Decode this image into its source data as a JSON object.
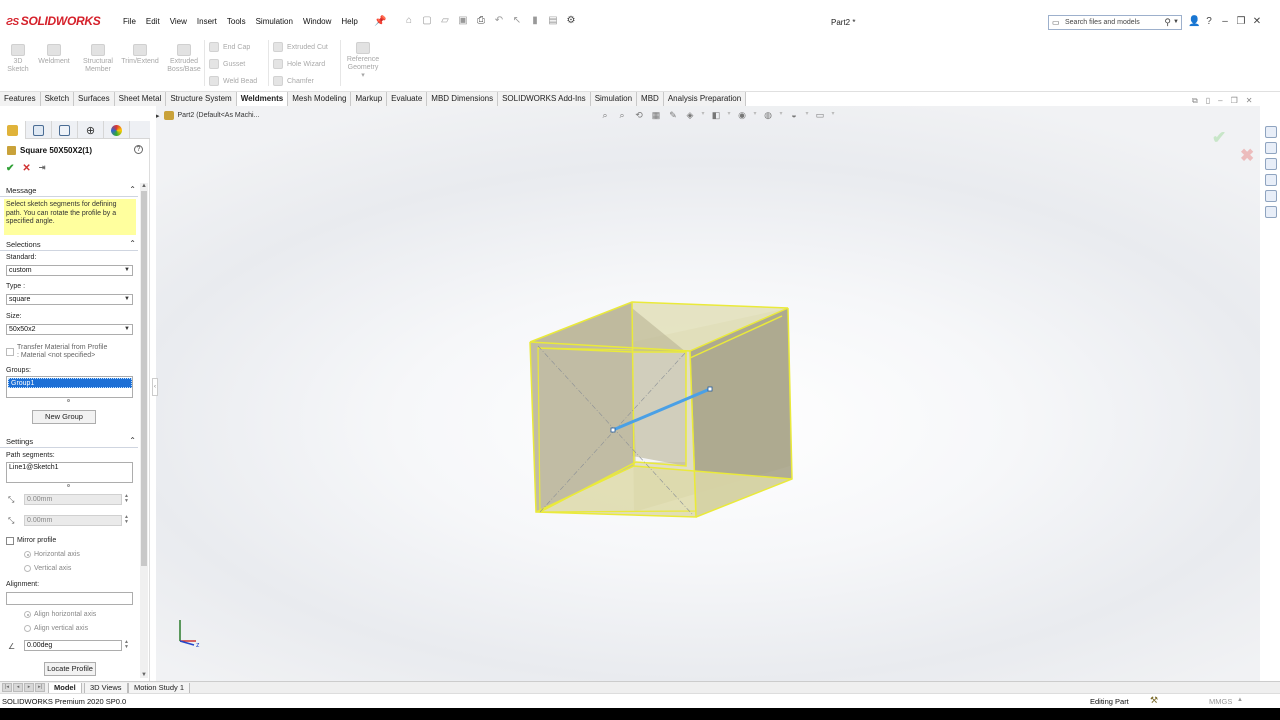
{
  "app": {
    "logo": "SOLIDWORKS",
    "document_title": "Part2 *",
    "menus": [
      "File",
      "Edit",
      "View",
      "Insert",
      "Tools",
      "Simulation",
      "Window",
      "Help"
    ],
    "search_placeholder": "Search files and models"
  },
  "toolbar": {
    "sketch3d": [
      "3D",
      "Sketch"
    ],
    "weldment": "Weldment",
    "structural_member": [
      "Structural",
      "Member"
    ],
    "trim_extend": "Trim/Extend",
    "extruded_boss": [
      "Extruded",
      "Boss/Base"
    ],
    "end_cap": "End Cap",
    "gusset": "Gusset",
    "weld_bead": "Weld Bead",
    "extruded_cut": "Extruded Cut",
    "hole_wizard": "Hole Wizard",
    "chamfer": "Chamfer",
    "reference_geometry": [
      "Reference",
      "Geometry"
    ]
  },
  "tabs": [
    "Features",
    "Sketch",
    "Surfaces",
    "Sheet Metal",
    "Structure System",
    "Weldments",
    "Mesh Modeling",
    "Markup",
    "Evaluate",
    "MBD Dimensions",
    "SOLIDWORKS Add-Ins",
    "Simulation",
    "MBD",
    "Analysis Preparation"
  ],
  "active_tab": "Weldments",
  "property_manager": {
    "title": "Square 50X50X2(1)",
    "message_header": "Message",
    "message": "Select sketch segments for defining path. You can rotate the profile by a specified angle.",
    "selections_header": "Selections",
    "standard_label": "Standard:",
    "standard_value": "custom",
    "type_label": "Type :",
    "type_value": "square",
    "size_label": "Size:",
    "size_value": "50x50x2",
    "transfer_material": "Transfer Material from Profile",
    "material_note": ": Material <not specified>",
    "groups_label": "Groups:",
    "group1": "Group1",
    "new_group": "New Group",
    "settings_header": "Settings",
    "path_segments_label": "Path segments:",
    "path_segment_value": "Line1@Sketch1",
    "offset1": "0.00mm",
    "offset2": "0.00mm",
    "mirror_profile": "Mirror profile",
    "horizontal_axis": "Horizontal axis",
    "vertical_axis": "Vertical axis",
    "alignment_label": "Alignment:",
    "align_horizontal": "Align horizontal axis",
    "align_vertical": "Align vertical axis",
    "angle": "0.00deg",
    "locate_profile": "Locate Profile"
  },
  "feature_tree": {
    "label": "Part2  (Default<As Machi..."
  },
  "bottom_tabs": [
    "Model",
    "3D Views",
    "Motion Study 1"
  ],
  "active_bottom_tab": "Model",
  "status": {
    "version": "SOLIDWORKS Premium 2020 SP0.0",
    "mode": "Editing Part",
    "units": "MMGS"
  },
  "colors": {
    "brand_red": "#d5202a",
    "selection_blue": "#1c6fd6",
    "message_yellow": "#ffff9e",
    "edge_highlight": "#eaea3a",
    "path_line": "#4aa0e6"
  },
  "triad": {
    "z_label": "z"
  }
}
